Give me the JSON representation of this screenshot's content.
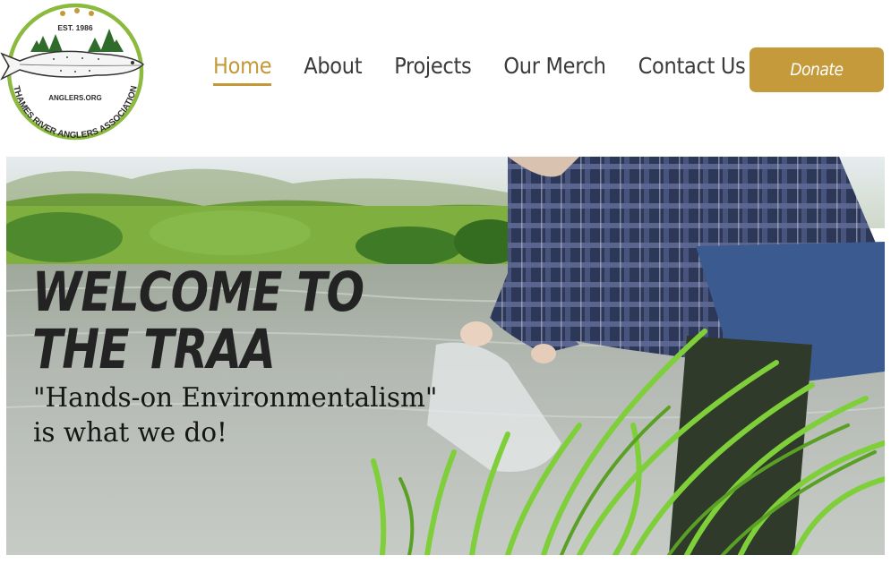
{
  "logo": {
    "est": "EST. 1986",
    "site": "ANGLERS.ORG",
    "org_name": "THAMES RIVER ANGLERS ASSOCIATION",
    "ring_color": "#8cba3e"
  },
  "nav": {
    "items": [
      {
        "label": "Home",
        "active": true
      },
      {
        "label": "About",
        "active": false
      },
      {
        "label": "Projects",
        "active": false
      },
      {
        "label": "Our Merch",
        "active": false
      },
      {
        "label": "Contact Us",
        "active": false
      }
    ],
    "accent_color": "#c39a37"
  },
  "donate": {
    "label": "Donate",
    "color": "#c49a3b"
  },
  "hero": {
    "title_line1": "WELCOME TO",
    "title_line2": "THE TRAA",
    "subtitle_line1": "\"Hands-on Environmentalism\"",
    "subtitle_line2": "is what we do!"
  }
}
